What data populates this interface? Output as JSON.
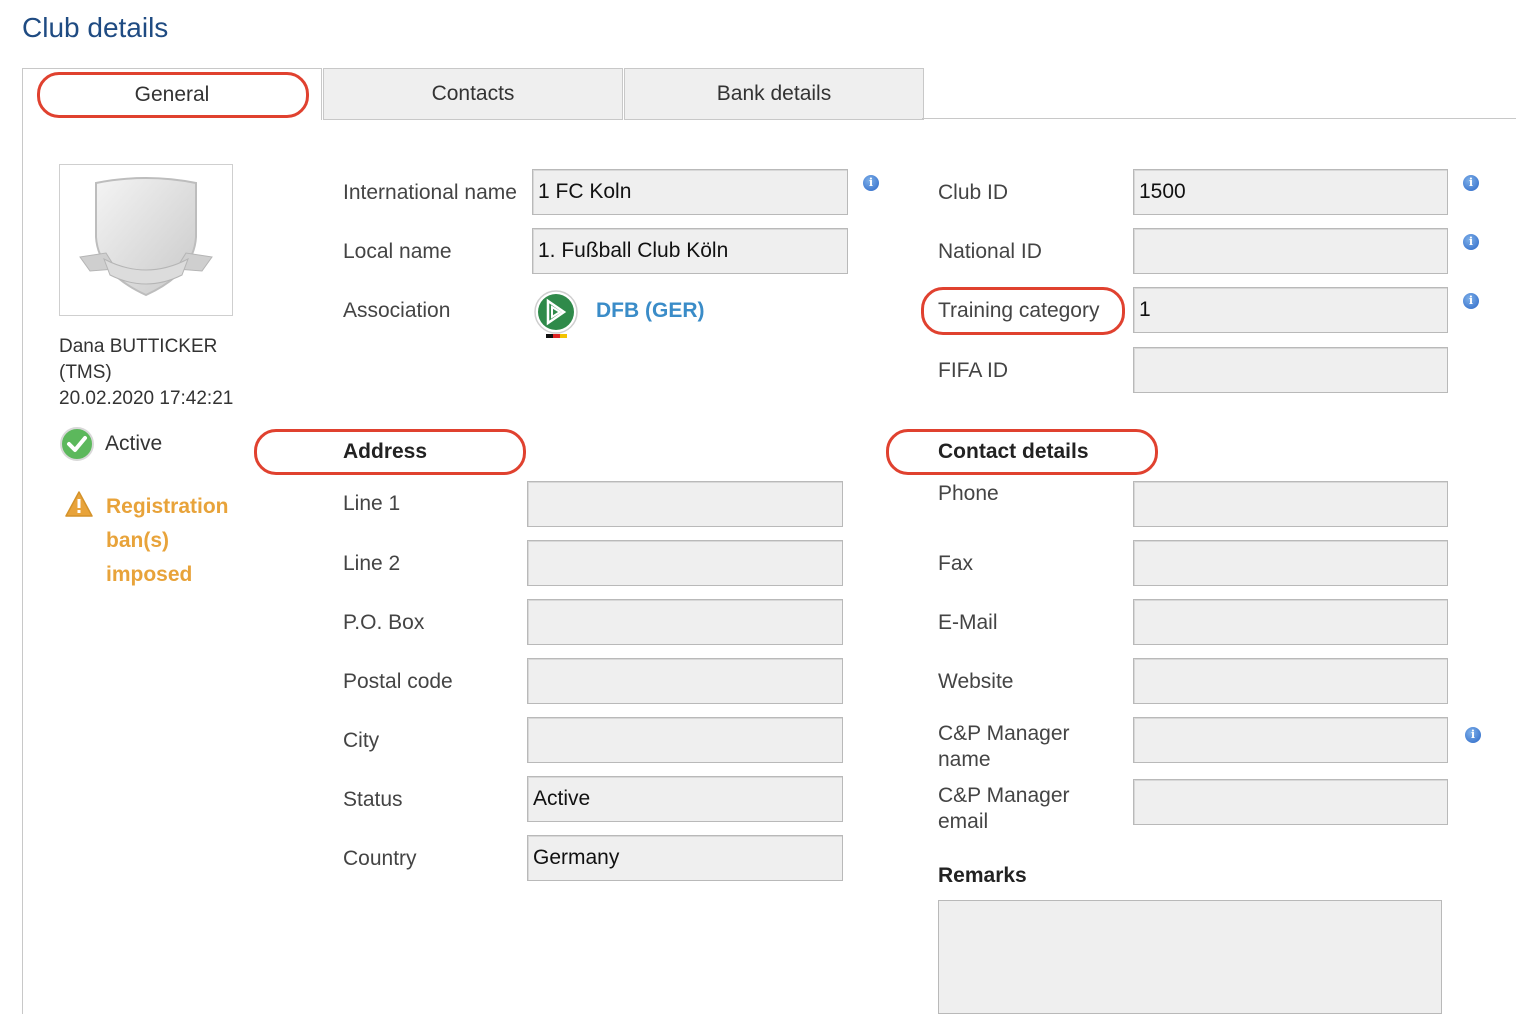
{
  "page_title": "Club details",
  "tabs": [
    {
      "label": "General",
      "active": true
    },
    {
      "label": "Contacts",
      "active": false
    },
    {
      "label": "Bank details",
      "active": false
    }
  ],
  "sidebar": {
    "user_name": "Dana BUTTICKER",
    "user_system": "(TMS)",
    "timestamp": "20.02.2020 17:42:21",
    "status_label": "Active",
    "warning_text": "Registration ban(s) imposed"
  },
  "club": {
    "international_name_label": "International name",
    "international_name_value": "1 FC Koln",
    "local_name_label": "Local name",
    "local_name_value": "1. Fußball Club Köln",
    "association_label": "Association",
    "association_value": "DFB (GER)",
    "club_id_label": "Club ID",
    "club_id_value": "1500",
    "national_id_label": "National ID",
    "national_id_value": "",
    "training_category_label": "Training category",
    "training_category_value": "1",
    "fifa_id_label": "FIFA ID",
    "fifa_id_value": ""
  },
  "address": {
    "heading": "Address",
    "fields": [
      {
        "label": "Line 1",
        "value": ""
      },
      {
        "label": "Line 2",
        "value": ""
      },
      {
        "label": "P.O. Box",
        "value": ""
      },
      {
        "label": "Postal code",
        "value": ""
      },
      {
        "label": "City",
        "value": ""
      },
      {
        "label": "Status",
        "value": "Active"
      },
      {
        "label": "Country",
        "value": "Germany"
      }
    ]
  },
  "contact": {
    "heading": "Contact details",
    "fields": [
      {
        "label": "Phone",
        "value": ""
      },
      {
        "label": "Fax",
        "value": ""
      },
      {
        "label": "E-Mail",
        "value": ""
      },
      {
        "label": "Website",
        "value": ""
      },
      {
        "label": "C&P Manager name",
        "value": ""
      },
      {
        "label": "C&P Manager email",
        "value": ""
      }
    ],
    "remarks_label": "Remarks",
    "remarks_value": ""
  },
  "colors": {
    "title": "#1f4b82",
    "highlight": "#e0412f",
    "warning": "#e8a33a",
    "link": "#3a8cc8",
    "active_check": "#5cb85c"
  },
  "icons": [
    "info-icon",
    "check-circle-icon",
    "warning-triangle-icon",
    "club-crest-placeholder",
    "dfb-logo"
  ]
}
